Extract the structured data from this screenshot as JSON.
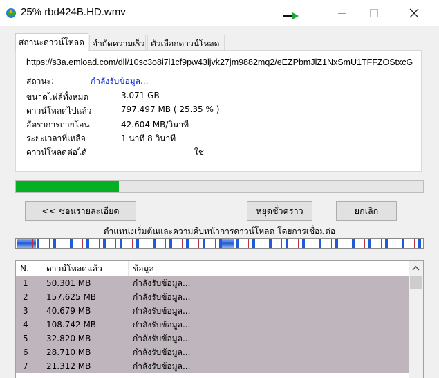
{
  "window": {
    "title": "25% rbd424B.HD.wmv"
  },
  "tabs": [
    {
      "label": "สถานะดาวน์โหลด"
    },
    {
      "label": "จำกัดความเร็ว"
    },
    {
      "label": "ตัวเลือกดาวน์โหลด"
    }
  ],
  "info": {
    "url": "https://s3a.emload.com/dll/10sc3o8i7l1cf9pw43ljvk27jm9882mq2/eEZPbmJlZ1NxSmU1TFFZOStxcG",
    "status_label": "สถานะ:",
    "status_value": "กำลังรับข้อมูล...",
    "rows": [
      {
        "label": "ขนาดไฟล์ทั้งหมด",
        "value": "3.071  GB"
      },
      {
        "label": "ดาวน์โหลดไปแล้ว",
        "value": "797.497  MB  ( 25.35 % )"
      },
      {
        "label": "อัตราการถ่ายโอน",
        "value": "42.604  MB/วินาที"
      },
      {
        "label": "ระยะเวลาที่เหลือ",
        "value": "1 นาที 8 วินาที"
      },
      {
        "label": "ดาวน์โหลดต่อได้",
        "value": "ใช่"
      }
    ]
  },
  "progress": {
    "fraction": 0.2535
  },
  "buttons": {
    "hide_details": "<< ซ่อนรายละเอียด",
    "pause": "หยุดชั่วคราว",
    "cancel": "ยกเลิก"
  },
  "connections_label": "ตำแหน่งเริ่มต้นและความคืบหน้าการดาวน์โหลด โดยการเชื่อมต่อ",
  "table": {
    "headers": [
      "N.",
      "ดาวน์โหลดแล้ว",
      "ข้อมูล"
    ],
    "rows": [
      {
        "n": "1",
        "downloaded": "50.301  MB",
        "info": "กำลังรับข้อมูล..."
      },
      {
        "n": "2",
        "downloaded": "157.625  MB",
        "info": "กำลังรับข้อมูล..."
      },
      {
        "n": "3",
        "downloaded": "40.679  MB",
        "info": "กำลังรับข้อมูล..."
      },
      {
        "n": "4",
        "downloaded": "108.742  MB",
        "info": "กำลังรับข้อมูล..."
      },
      {
        "n": "5",
        "downloaded": "32.820  MB",
        "info": "กำลังรับข้อมูล..."
      },
      {
        "n": "6",
        "downloaded": "28.710  MB",
        "info": "กำลังรับข้อมูล..."
      },
      {
        "n": "7",
        "downloaded": "21.312  MB",
        "info": "กำลังรับข้อมูล..."
      }
    ]
  },
  "colors": {
    "progress_fill": "#06b025",
    "status_text": "#0a2bd6",
    "row_bg": "#bfb5bc",
    "segment_blue": "#1f5bd8",
    "segment_tick": "#c03040"
  },
  "icons": {
    "app": "idm-globe-icon",
    "arrow": "green-arrow-icon",
    "minimize": "minimize-icon",
    "maximize": "maximize-icon",
    "close": "close-icon",
    "scroll_up": "chevron-up-icon",
    "scroll_down": "chevron-down-icon"
  }
}
